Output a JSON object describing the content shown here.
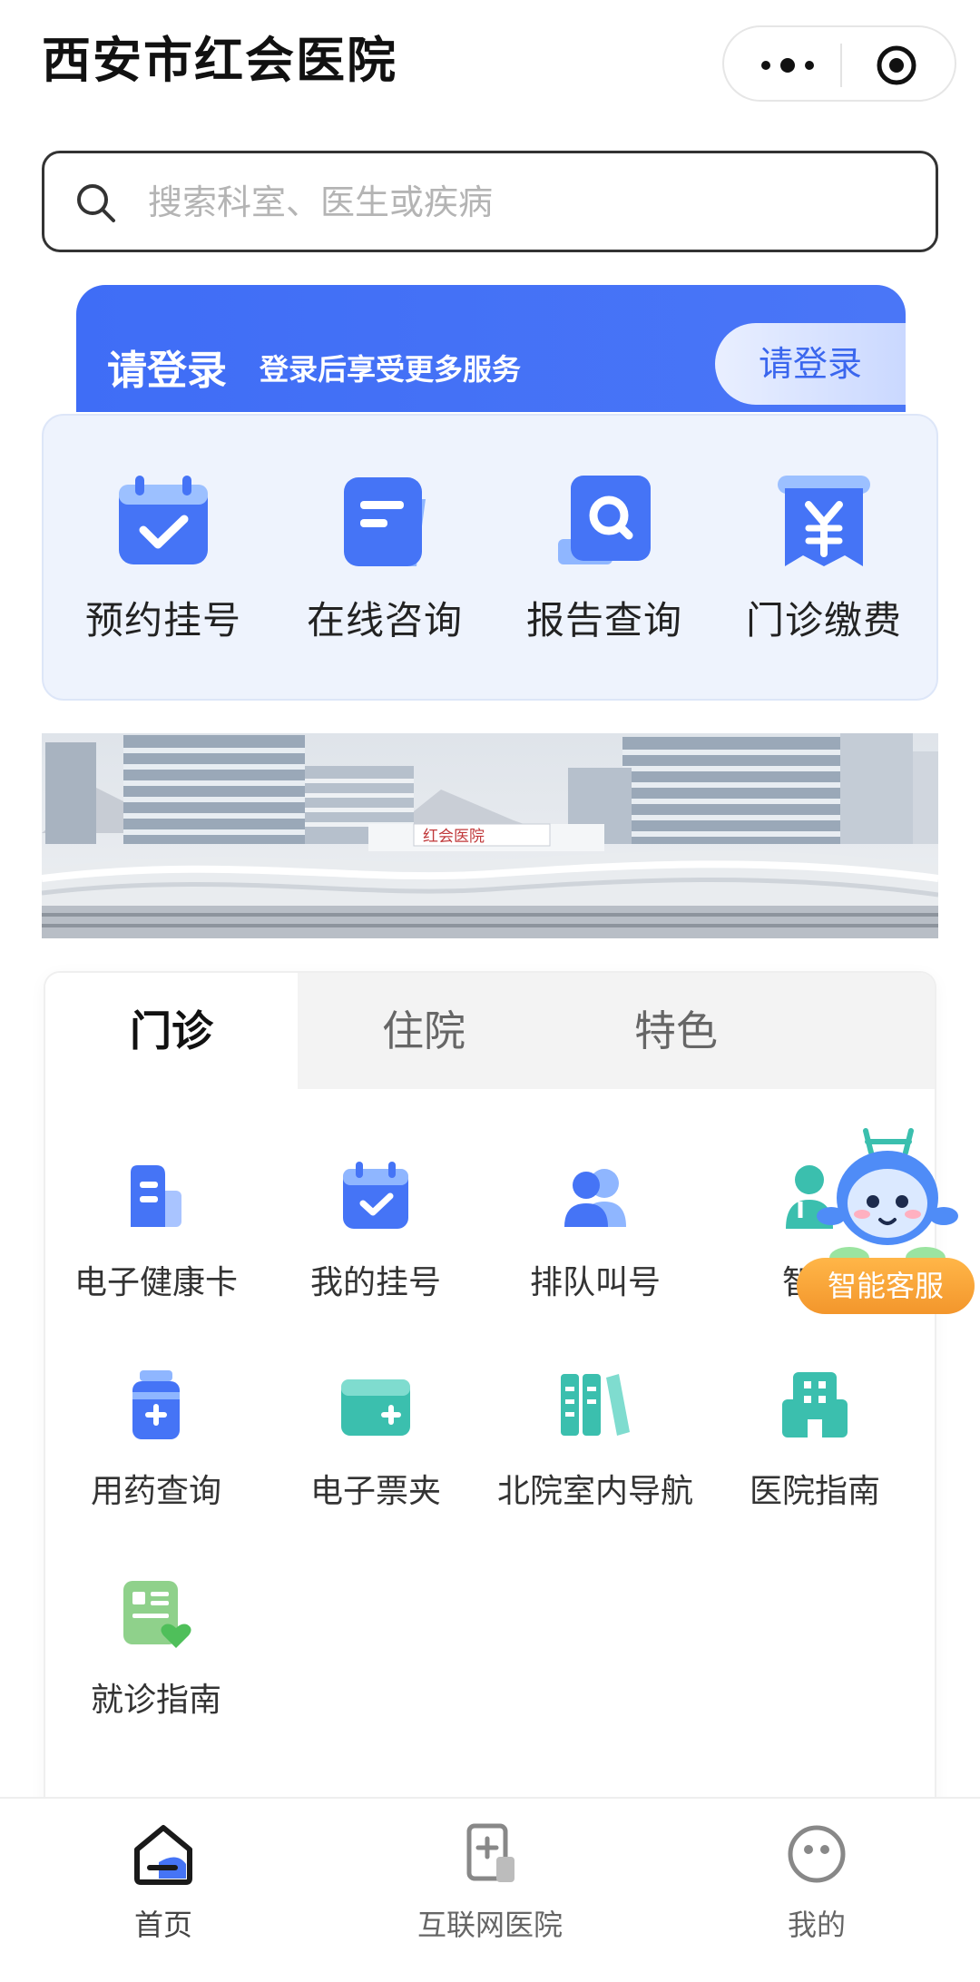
{
  "header": {
    "title": "西安市红会医院"
  },
  "search": {
    "placeholder": "搜索科室、医生或疾病"
  },
  "login_banner": {
    "title": "请登录",
    "subtitle": "登录后享受更多服务",
    "button_label": "请登录"
  },
  "quick_actions": [
    {
      "label": "预约挂号",
      "icon": "calendar-check-icon"
    },
    {
      "label": "在线咨询",
      "icon": "chat-document-icon"
    },
    {
      "label": "报告查询",
      "icon": "report-search-icon"
    },
    {
      "label": "门诊缴费",
      "icon": "payment-yen-icon"
    }
  ],
  "banner_sign": "红会医院",
  "service_tabs": [
    {
      "label": "门诊",
      "active": true
    },
    {
      "label": "住院"
    },
    {
      "label": "特色"
    }
  ],
  "services": [
    {
      "label": "电子健康卡",
      "icon": "health-card-icon"
    },
    {
      "label": "我的挂号",
      "icon": "calendar-check-icon"
    },
    {
      "label": "排队叫号",
      "icon": "queue-people-icon"
    },
    {
      "label": "智能",
      "icon": "doctor-icon"
    },
    {
      "label": "用药查询",
      "icon": "medicine-bottle-icon"
    },
    {
      "label": "电子票夹",
      "icon": "ticket-wallet-icon"
    },
    {
      "label": "北院室内导航",
      "icon": "navigation-book-icon"
    },
    {
      "label": "医院指南",
      "icon": "hospital-building-icon"
    },
    {
      "label": "就诊指南",
      "icon": "guide-document-icon"
    }
  ],
  "float_service": {
    "label": "智能客服"
  },
  "tabbar": [
    {
      "label": "首页",
      "icon": "home-icon",
      "active": true
    },
    {
      "label": "互联网医院",
      "icon": "internet-hospital-icon"
    },
    {
      "label": "我的",
      "icon": "profile-face-icon"
    }
  ],
  "colors": {
    "primary": "#3f6df6",
    "teal": "#3bbfae",
    "orange": "#f3962c",
    "panel_bg": "#eef3fd"
  }
}
